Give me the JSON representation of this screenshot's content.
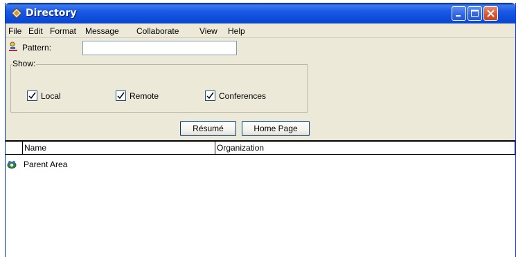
{
  "window": {
    "title": "Directory"
  },
  "menu": [
    "File",
    "Edit",
    "Format",
    "Message",
    "Collaborate",
    "View",
    "Help"
  ],
  "pattern": {
    "label": "Pattern:",
    "value": ""
  },
  "show": {
    "legend": "Show:",
    "options": [
      {
        "label": "Local",
        "checked": true
      },
      {
        "label": "Remote",
        "checked": true
      },
      {
        "label": "Conferences",
        "checked": true
      }
    ]
  },
  "buttons": {
    "resume": "Résumé",
    "home_page": "Home Page"
  },
  "list": {
    "columns": [
      "Name",
      "Organization"
    ],
    "rows": [
      {
        "name": "Parent Area",
        "icon": "conference-area-icon"
      }
    ]
  },
  "colors": {
    "titlebar": "#0b45c8",
    "window_bg": "#ece9d8",
    "close_button": "#d9542e"
  }
}
